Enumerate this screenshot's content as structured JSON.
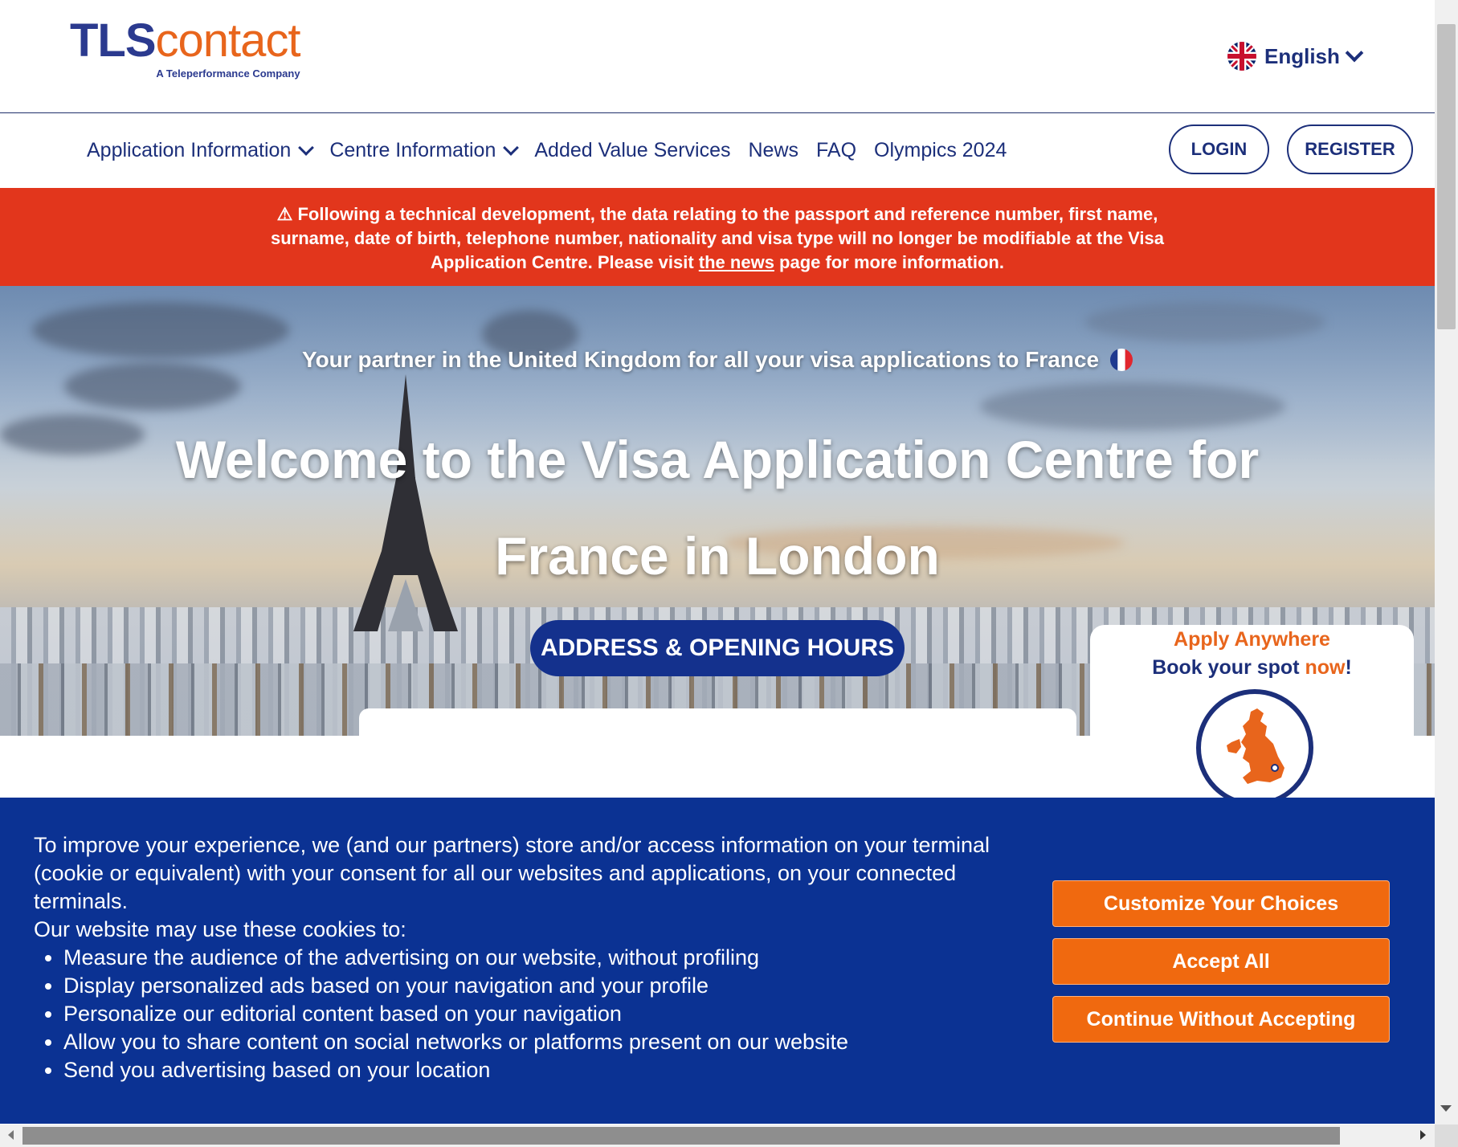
{
  "header": {
    "logo_tls": "TLS",
    "logo_contact": "contact",
    "logo_tagline": "A Teleperformance Company",
    "language": "English",
    "language_icon": "uk-flag-icon"
  },
  "nav": {
    "items": [
      {
        "label": "Application Information",
        "dropdown": true
      },
      {
        "label": "Centre Information",
        "dropdown": true
      },
      {
        "label": "Added Value Services",
        "dropdown": false
      },
      {
        "label": "News",
        "dropdown": false
      },
      {
        "label": "FAQ",
        "dropdown": false
      },
      {
        "label": "Olympics 2024",
        "dropdown": false
      }
    ],
    "login": "LOGIN",
    "register": "REGISTER"
  },
  "alert": {
    "icon": "warning-icon",
    "text_before": "Following a technical development, the data relating to the passport and reference number, first name, surname, date of birth, telephone number, nationality and visa type will no longer be modifiable at the Visa Application Centre. Please visit ",
    "link": "the news",
    "text_after": " page for more information."
  },
  "hero": {
    "subtitle": "Your partner in the United Kingdom for all your visa applications to France",
    "flag_icon": "france-flag-icon",
    "title_line1": "Welcome to the Visa Application Centre for",
    "title_line2": "France in London",
    "hours_button": "ADDRESS & OPENING HOURS"
  },
  "apply_card": {
    "line1": "Apply Anywhere",
    "line2_prefix": "Book your spot ",
    "line2_now": "now",
    "line2_suffix": "!",
    "map_icon": "uk-map-icon"
  },
  "cookie": {
    "intro": "To improve your experience, we (and our partners) store and/or access information on your terminal (cookie or equivalent) with your consent for all our websites and applications, on your connected terminals.",
    "list_intro": "Our website may use these cookies to:",
    "uses": [
      "Measure the audience of the advertising on our website, without profiling",
      "Display personalized ads based on your navigation and your profile",
      "Personalize our editorial content based on your navigation",
      "Allow you to share content on social networks or platforms present on our website",
      "Send you advertising based on your location"
    ],
    "customize": "Customize Your Choices",
    "accept": "Accept All",
    "continue": "Continue Without Accepting"
  },
  "colors": {
    "brand_blue": "#1c2f7a",
    "brand_orange": "#e8651c",
    "alert_red": "#e2361c",
    "cookie_blue": "#0b3293",
    "cookie_button": "#f0690f"
  }
}
